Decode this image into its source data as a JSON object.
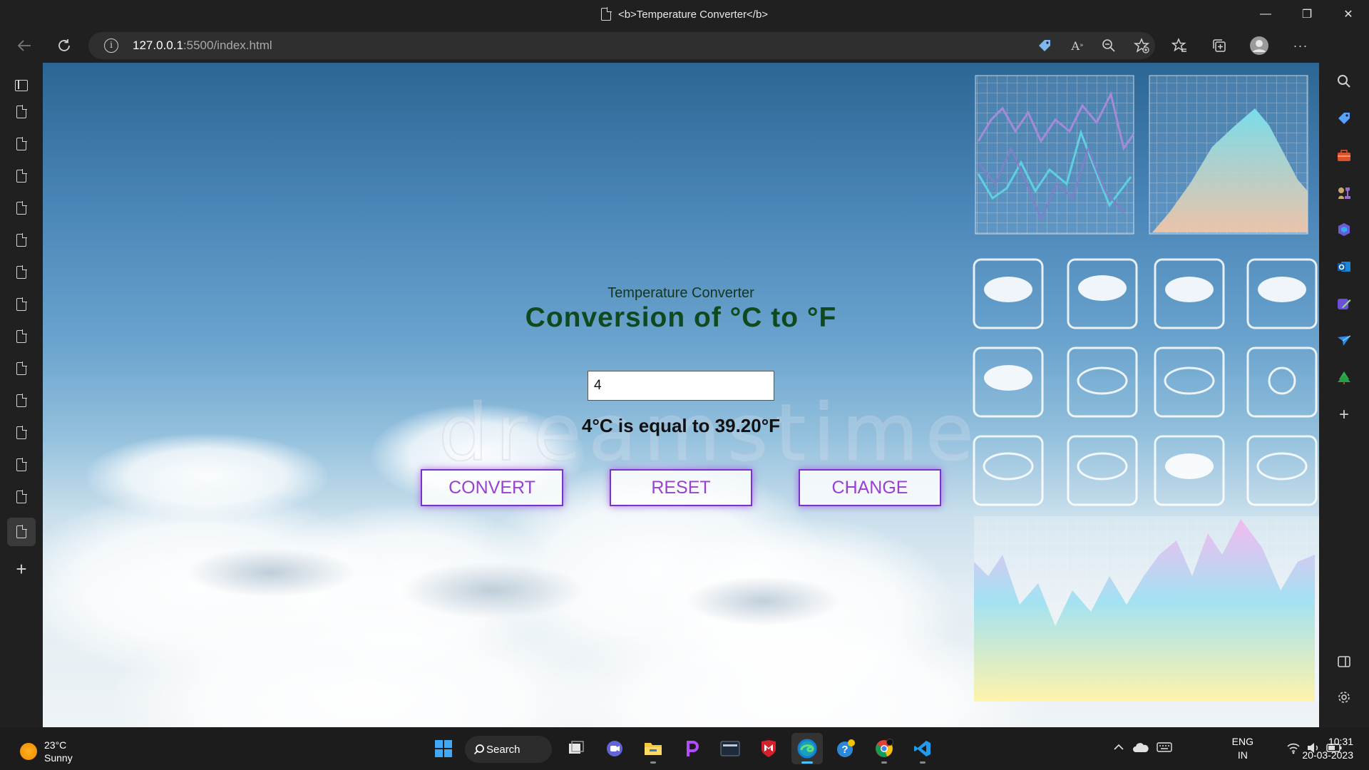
{
  "window": {
    "title": "<b>Temperature Converter</b>",
    "controls": {
      "minimize": "—",
      "restore": "❐",
      "close": "✕"
    }
  },
  "toolbar": {
    "url_host": "127.0.0.1",
    "url_rest": ":5500/index.html",
    "icons": [
      "back-arrow-icon",
      "refresh-icon",
      "site-info-icon",
      "tag-icon",
      "read-aloud-icon",
      "zoom-out-icon",
      "add-favorite-icon",
      "favorites-icon",
      "collections-icon",
      "profile-icon",
      "more-icon",
      "bing-icon"
    ]
  },
  "vertical_tabs": {
    "count": 14,
    "active_index": 14
  },
  "page": {
    "subtitle": "Temperature Converter",
    "heading": "Conversion of °C to °F",
    "input_value": "4",
    "result": "4°C is equal to 39.20°F",
    "buttons": {
      "convert": "CONVERT",
      "reset": "RESET",
      "change": "CHANGE"
    },
    "watermark": "dreamstime",
    "colors": {
      "heading": "#0f4a1e",
      "button_text": "#9b3fd4",
      "button_border": "#7a33c8"
    }
  },
  "taskbar": {
    "weather": {
      "temp": "23°C",
      "condition": "Sunny"
    },
    "search_label": "Search",
    "language": {
      "line1": "ENG",
      "line2": "IN"
    },
    "time": "10:31",
    "date": "20-03-2023"
  }
}
